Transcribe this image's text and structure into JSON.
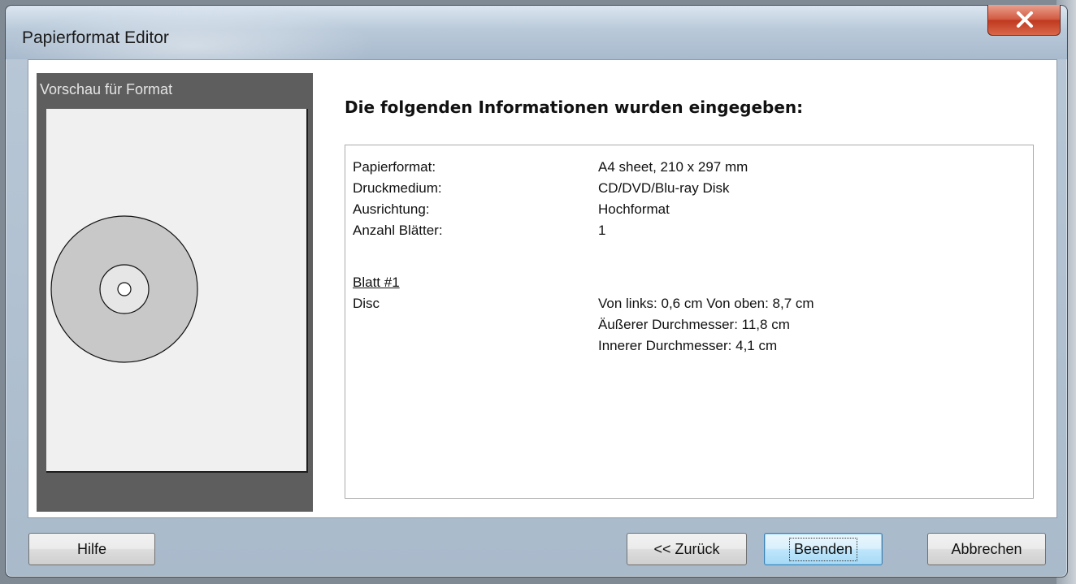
{
  "window": {
    "title": "Papierformat Editor"
  },
  "preview": {
    "label": "Vorschau für Format"
  },
  "summary": {
    "heading": "Die folgenden Informationen wurden eingegeben:",
    "rows": [
      {
        "label": "Papierformat:",
        "value": "A4 sheet, 210 x 297 mm"
      },
      {
        "label": "Druckmedium:",
        "value": "CD/DVD/Blu-ray Disk"
      },
      {
        "label": "Ausrichtung:",
        "value": "Hochformat"
      },
      {
        "label": "Anzahl Blätter:",
        "value": "1"
      }
    ],
    "sheet_title": "Blatt #1",
    "item_label": "Disc",
    "item_values": [
      "Von links: 0,6 cm Von oben: 8,7 cm",
      "Äußerer Durchmesser: 11,8 cm",
      "Innerer Durchmesser: 4,1 cm"
    ]
  },
  "buttons": {
    "help": "Hilfe",
    "back": "<< Zurück",
    "finish": "Beenden",
    "cancel": "Abbrechen"
  },
  "colors": {
    "close_button": "#c0391f",
    "preview_panel": "#5e5e5e",
    "disc_fill": "#c8c8c8"
  }
}
